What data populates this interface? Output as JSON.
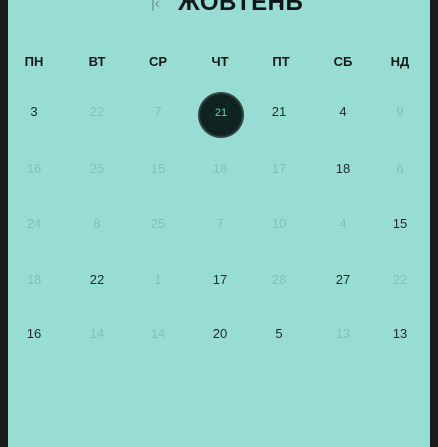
{
  "header": {
    "prev_icon": "chevron-left-icon",
    "month": "ЖОВТЕНЬ",
    "next_icon": "chevron-right-icon"
  },
  "weekdays": [
    "ПН",
    "ВТ",
    "СР",
    "ЧТ",
    "ПТ",
    "СБ",
    "НД"
  ],
  "selected_day": "21",
  "days": [
    {
      "text": "3",
      "tone": "dark"
    },
    {
      "text": "22",
      "tone": "muted"
    },
    {
      "text": "7",
      "tone": "muted"
    },
    {
      "text": "21",
      "tone": "dark"
    },
    {
      "text": "4",
      "tone": "dark"
    },
    {
      "text": "9",
      "tone": "muted"
    },
    {
      "text": "16",
      "tone": "muted"
    },
    {
      "text": "25",
      "tone": "muted"
    },
    {
      "text": "15",
      "tone": "muted"
    },
    {
      "text": "18",
      "tone": "muted"
    },
    {
      "text": "17",
      "tone": "muted"
    },
    {
      "text": "18",
      "tone": "dark"
    },
    {
      "text": "6",
      "tone": "muted"
    },
    {
      "text": "24",
      "tone": "muted"
    },
    {
      "text": "8",
      "tone": "muted"
    },
    {
      "text": "25",
      "tone": "muted"
    },
    {
      "text": "7",
      "tone": "muted"
    },
    {
      "text": "10",
      "tone": "muted"
    },
    {
      "text": "4",
      "tone": "muted"
    },
    {
      "text": "15",
      "tone": "dark"
    },
    {
      "text": "18",
      "tone": "muted"
    },
    {
      "text": "22",
      "tone": "dark"
    },
    {
      "text": "1",
      "tone": "muted"
    },
    {
      "text": "17",
      "tone": "dark"
    },
    {
      "text": "28",
      "tone": "muted"
    },
    {
      "text": "27",
      "tone": "dark"
    },
    {
      "text": "22",
      "tone": "muted"
    },
    {
      "text": "16",
      "tone": "dark"
    },
    {
      "text": "14",
      "tone": "muted"
    },
    {
      "text": "14",
      "tone": "muted"
    },
    {
      "text": "20",
      "tone": "dark"
    },
    {
      "text": "5",
      "tone": "dark"
    },
    {
      "text": "13",
      "tone": "muted"
    },
    {
      "text": "13",
      "tone": "dark"
    }
  ],
  "colors": {
    "background": "#97ddd3",
    "selected_circle": "#0f2420",
    "dark_text": "#1f2a29",
    "muted_text": "#7fc3b8"
  }
}
